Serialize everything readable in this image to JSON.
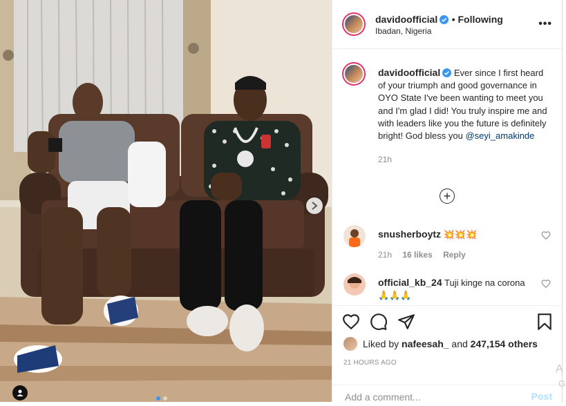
{
  "post": {
    "username": "davidoofficial",
    "follow_status": "Following",
    "location": "Ibadan, Nigeria",
    "caption_text": "Ever since I first heard of your triumph and good governance in OYO State I've been wanting to meet you and I'm glad I did! You truly inspire me and with leaders like you the future is definitely bright! God bless you",
    "caption_mention": "@seyi_amakinde",
    "caption_time": "21h",
    "carousel": {
      "total": 2,
      "active_index": 1
    }
  },
  "comments": [
    {
      "username": "snusherboytz",
      "text": "💥💥💥",
      "time": "21h",
      "likes": "16 likes",
      "reply": "Reply"
    },
    {
      "username": "official_kb_24",
      "text": "Tuji kinge na corona 🙏🙏🙏"
    }
  ],
  "likes": {
    "prefix": "Liked by",
    "user": "nafeesah_",
    "connector": "and",
    "count": "247,154 others"
  },
  "timestamp": "21 HOURS AGO",
  "add_comment": {
    "placeholder": "Add a comment...",
    "post_label": "Post"
  },
  "icons": {
    "more": "more-options-icon",
    "verified": "verified-badge-icon",
    "load_more": "load-more-comments-icon",
    "like": "heart-icon",
    "comment": "comment-icon",
    "share": "share-icon",
    "save": "bookmark-icon",
    "next": "chevron-right-icon",
    "tag": "user-tag-icon"
  },
  "colors": {
    "verified": "#3897f0",
    "mention": "#00376b",
    "post_button": "#b2dffc",
    "meta_gray": "#8e8e8e"
  },
  "edge": {
    "letter1": "A",
    "letter2": "Go"
  }
}
